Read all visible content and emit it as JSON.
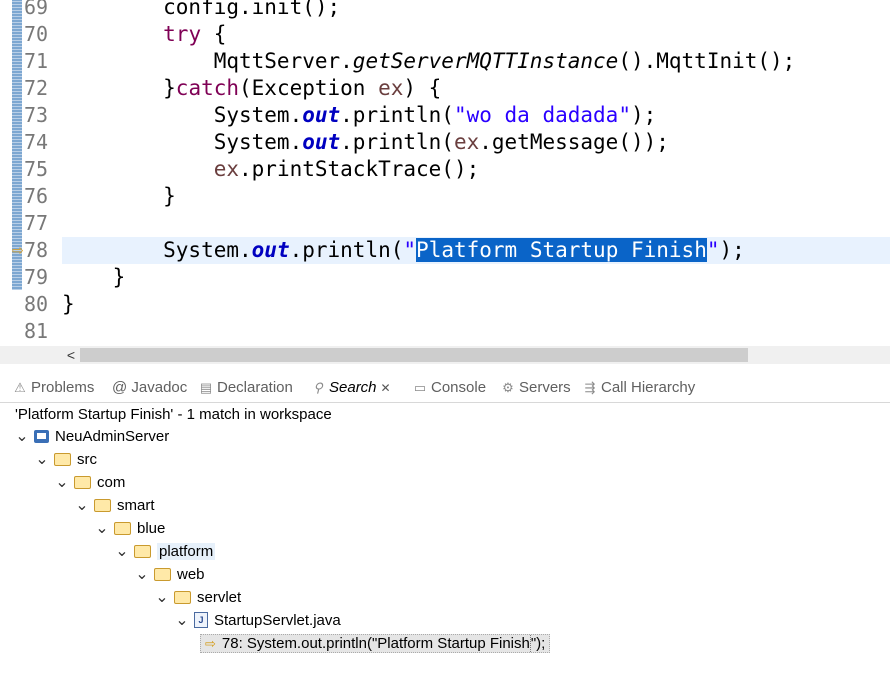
{
  "editor": {
    "lines": [
      {
        "num": "69",
        "segments": [
          [
            "",
            "        config.init();"
          ]
        ]
      },
      {
        "num": "70",
        "segments": [
          [
            "",
            "        "
          ],
          [
            "kw",
            "try"
          ],
          [
            "",
            " {"
          ]
        ]
      },
      {
        "num": "71",
        "segments": [
          [
            "",
            "            MqttServer."
          ],
          [
            "mth",
            "getServerMQTTInstance"
          ],
          [
            "",
            "().MqttInit();"
          ]
        ]
      },
      {
        "num": "72",
        "segments": [
          [
            "",
            "        }"
          ],
          [
            "kw",
            "catch"
          ],
          [
            "",
            "(Exception "
          ],
          [
            "var",
            "ex"
          ],
          [
            "",
            ") {"
          ]
        ]
      },
      {
        "num": "73",
        "segments": [
          [
            "",
            "            System."
          ],
          [
            "fld",
            "out"
          ],
          [
            "",
            ".println("
          ],
          [
            "str",
            "\"wo da dadada\""
          ],
          [
            "",
            ");"
          ]
        ]
      },
      {
        "num": "74",
        "segments": [
          [
            "",
            "            System."
          ],
          [
            "fld",
            "out"
          ],
          [
            "",
            ".println("
          ],
          [
            "var",
            "ex"
          ],
          [
            "",
            ".getMessage());"
          ]
        ]
      },
      {
        "num": "75",
        "segments": [
          [
            "",
            "            "
          ],
          [
            "var",
            "ex"
          ],
          [
            "",
            ".printStackTrace();"
          ]
        ]
      },
      {
        "num": "76",
        "segments": [
          [
            "",
            "        }"
          ]
        ]
      },
      {
        "num": "77",
        "segments": [
          [
            "",
            ""
          ]
        ]
      },
      {
        "num": "78",
        "current": true,
        "segments": [
          [
            "",
            "        System."
          ],
          [
            "fld",
            "out"
          ],
          [
            "",
            ".println("
          ],
          [
            "str",
            "\""
          ],
          [
            "sel",
            "Platform Startup Finish"
          ],
          [
            "str",
            "\""
          ],
          [
            "",
            ");"
          ]
        ]
      },
      {
        "num": "79",
        "segments": [
          [
            "",
            "    }"
          ]
        ]
      },
      {
        "num": "80",
        "segments": [
          [
            "",
            "}"
          ]
        ]
      },
      {
        "num": "81",
        "segments": [
          [
            "",
            ""
          ]
        ]
      }
    ]
  },
  "tabs": [
    {
      "label": "Problems",
      "icon": "problems-icon",
      "glyph": "⚠"
    },
    {
      "label": "@ Javadoc",
      "icon": "javadoc-icon",
      "glyph": ""
    },
    {
      "label": "Declaration",
      "icon": "declaration-icon",
      "glyph": "▤"
    },
    {
      "label": "Search",
      "icon": "search-icon",
      "glyph": "⚲",
      "active": true
    },
    {
      "label": "Console",
      "icon": "console-icon",
      "glyph": "▭"
    },
    {
      "label": "Servers",
      "icon": "servers-icon",
      "glyph": "⚙"
    },
    {
      "label": "Call Hierarchy",
      "icon": "call-hierarchy-icon",
      "glyph": "⇶"
    }
  ],
  "search": {
    "summary": "'Platform Startup Finish' - 1 match in workspace",
    "tree": [
      {
        "depth": 0,
        "label": "NeuAdminServer",
        "type": "project"
      },
      {
        "depth": 1,
        "label": "src",
        "type": "folder"
      },
      {
        "depth": 2,
        "label": "com",
        "type": "folder"
      },
      {
        "depth": 3,
        "label": "smart",
        "type": "folder"
      },
      {
        "depth": 4,
        "label": "blue",
        "type": "folder"
      },
      {
        "depth": 5,
        "label": "platform",
        "type": "folder",
        "highlight": true
      },
      {
        "depth": 6,
        "label": "web",
        "type": "folder"
      },
      {
        "depth": 7,
        "label": "servlet",
        "type": "folder"
      },
      {
        "depth": 8,
        "label": "StartupServlet.java",
        "type": "java"
      }
    ],
    "match": {
      "prefix": "78: System.out.println(\"",
      "term": "Platform Startup Finish",
      "suffix": "\");"
    }
  }
}
